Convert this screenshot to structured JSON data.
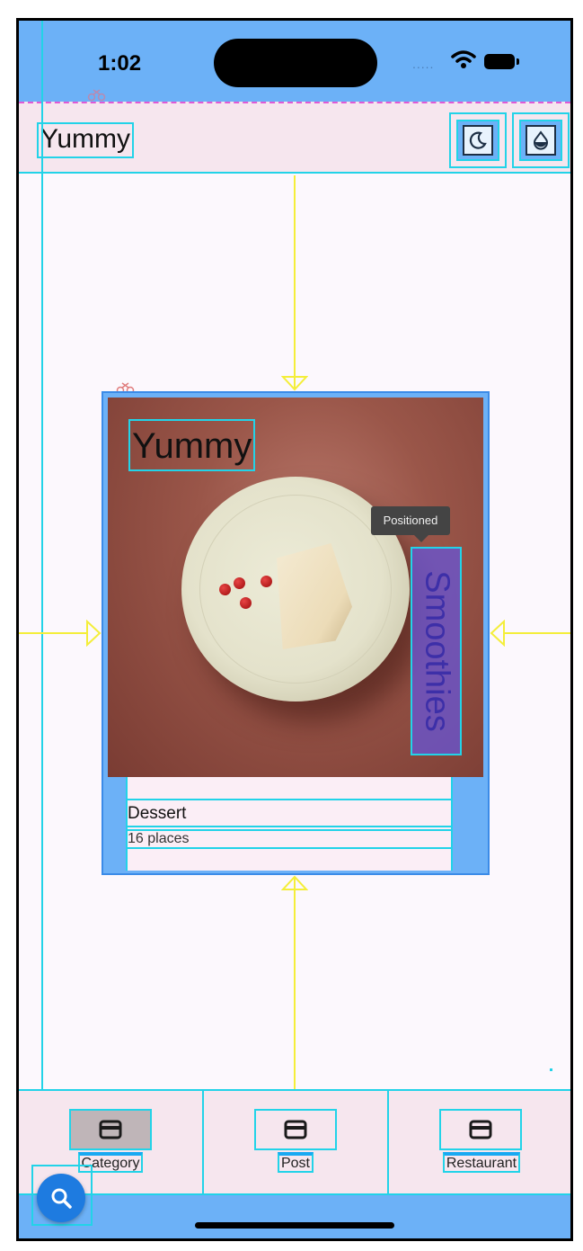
{
  "status_bar": {
    "time": "1:02",
    "signal": "....."
  },
  "app_bar": {
    "title": "Yummy",
    "buttons": [
      {
        "name": "theme-toggle-button",
        "icon": "moon-icon"
      },
      {
        "name": "color-button",
        "icon": "drop-icon"
      }
    ]
  },
  "card": {
    "image_title": "Yummy",
    "overlay_label": "Smoothies",
    "tooltip": "Positioned",
    "heading": "Dessert",
    "subheading": "16 places"
  },
  "bottom_nav": {
    "items": [
      {
        "label": "Category",
        "icon": "card-icon",
        "active": true
      },
      {
        "label": "Post",
        "icon": "card-icon",
        "active": false
      },
      {
        "label": "Restaurant",
        "icon": "card-icon",
        "active": false
      }
    ]
  },
  "fab": {
    "icon": "search-icon"
  },
  "colors": {
    "accent": "#6cb1f7",
    "debug_outline": "#22d3e8",
    "guide_line": "#f4ee3a",
    "surface": "#f6e6ee",
    "overlay_label_bg": "#6854d2"
  }
}
